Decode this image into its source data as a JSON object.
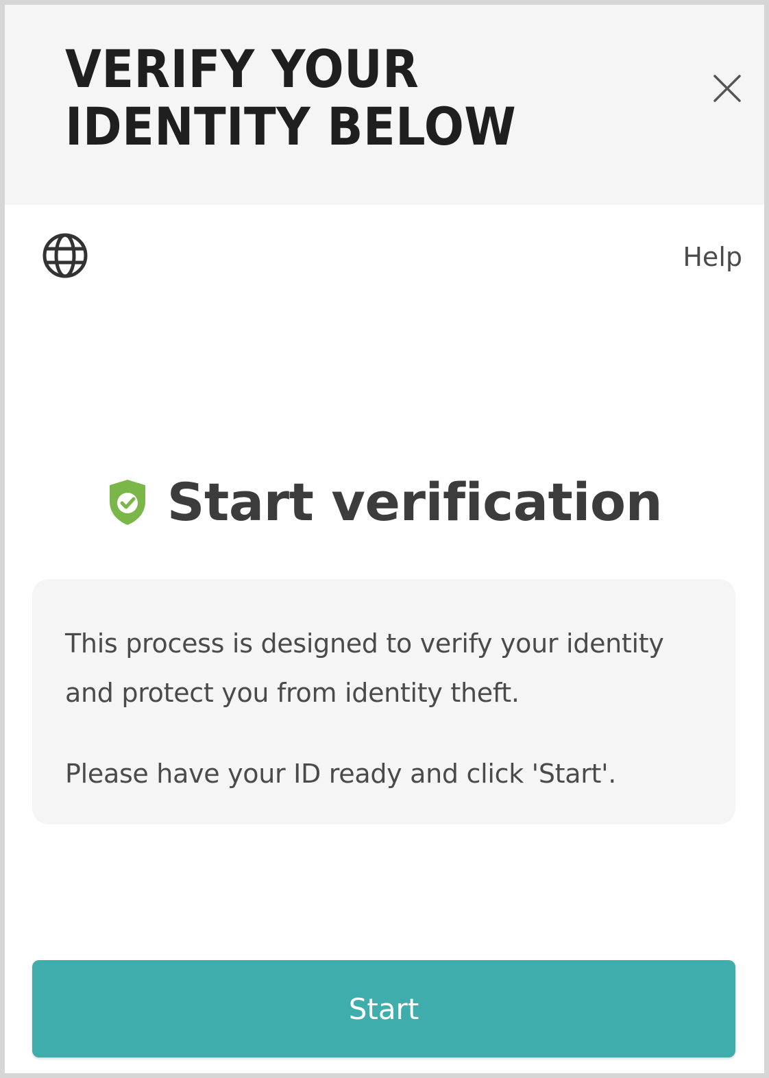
{
  "header": {
    "title": "VERIFY YOUR IDENTITY BELOW",
    "close_icon": "close-icon"
  },
  "toolbar": {
    "language_icon": "globe-icon",
    "help_label": "Help"
  },
  "main": {
    "heading_icon": "shield-check-icon",
    "heading": "Start verification",
    "info_paragraph_1": "This process is designed to verify your identity and protect you from identity theft.",
    "info_paragraph_2": "Please have your ID ready and click 'Start'.",
    "start_label": "Start"
  },
  "colors": {
    "header_bg": "#f5f5f5",
    "accent": "#40adad",
    "shield_green": "#7ab648",
    "text_dark": "#1f1f1f",
    "text_body": "#4a4a4a"
  }
}
